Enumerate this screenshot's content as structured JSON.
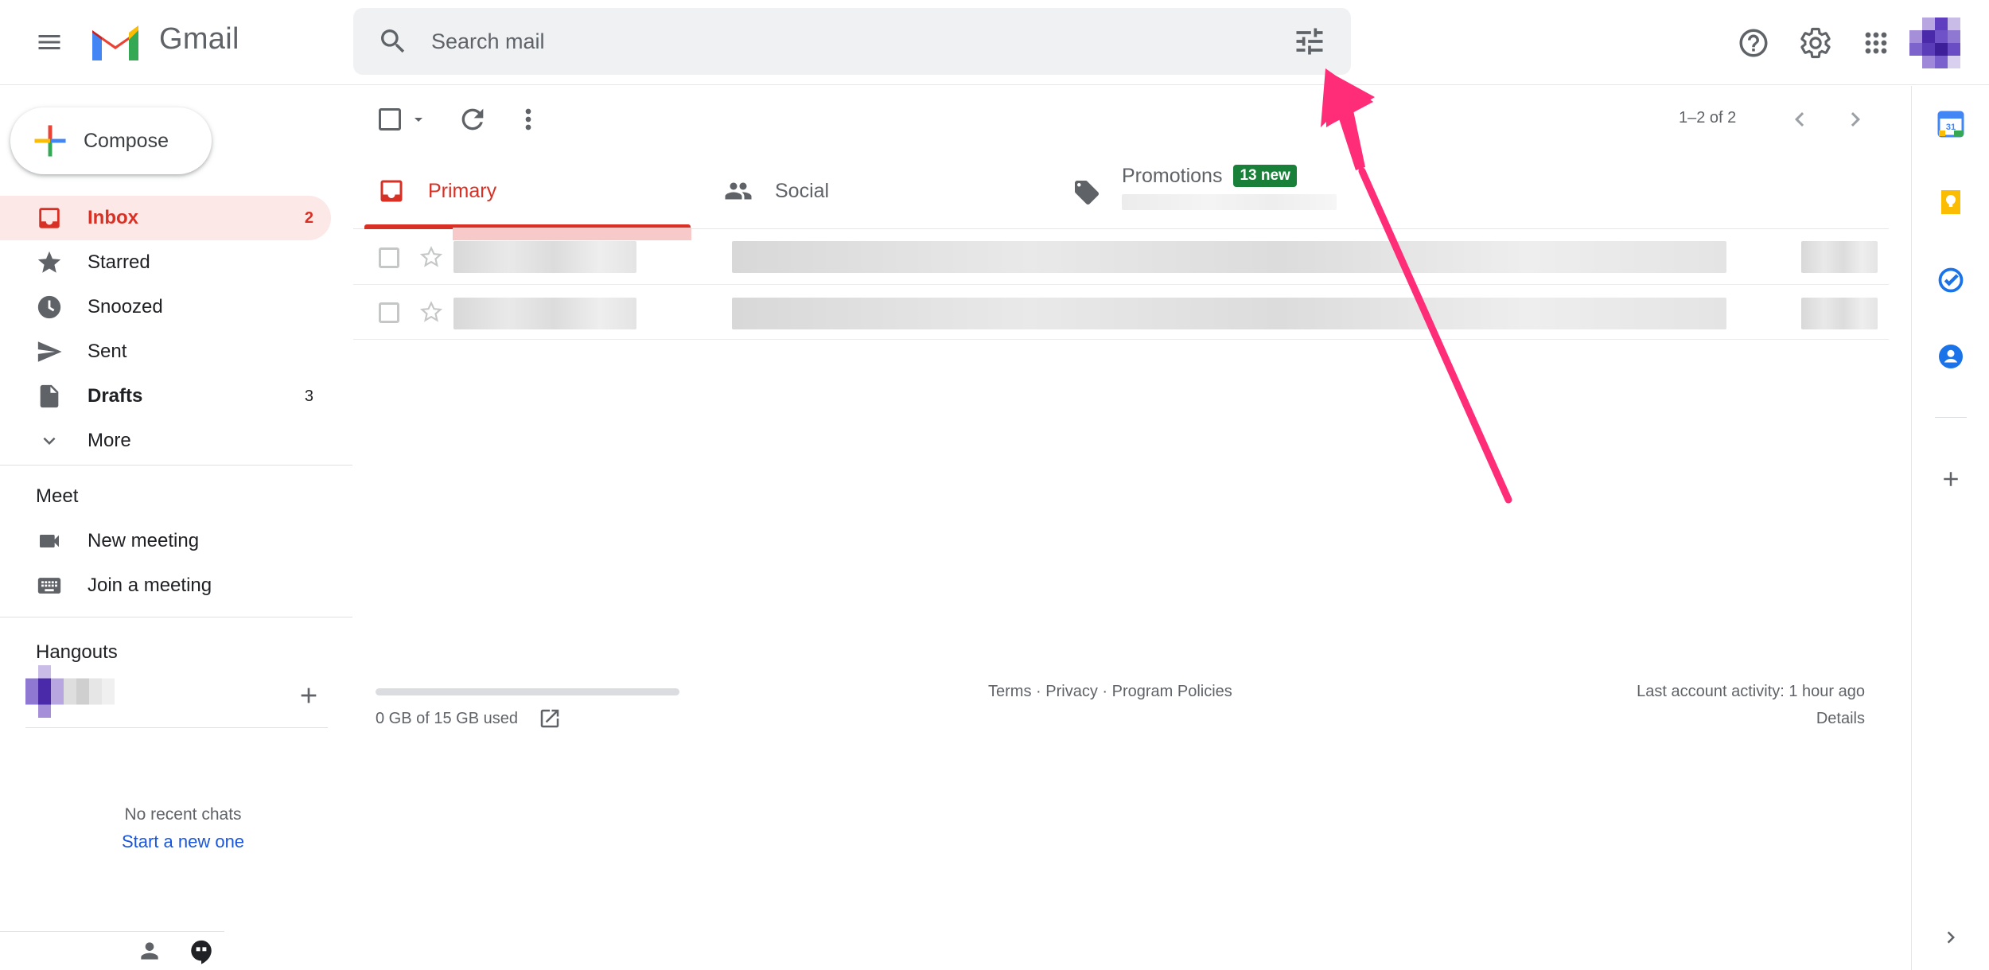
{
  "app": {
    "brand": "Gmail"
  },
  "search": {
    "placeholder": "Search mail"
  },
  "compose": {
    "label": "Compose"
  },
  "sidebar": {
    "items": [
      {
        "label": "Inbox",
        "count": "2",
        "icon": "inbox-icon"
      },
      {
        "label": "Starred",
        "count": "",
        "icon": "star-icon"
      },
      {
        "label": "Snoozed",
        "count": "",
        "icon": "clock-icon"
      },
      {
        "label": "Sent",
        "count": "",
        "icon": "send-icon"
      },
      {
        "label": "Drafts",
        "count": "3",
        "icon": "draft-icon"
      },
      {
        "label": "More",
        "count": "",
        "icon": "chevron-down-icon"
      }
    ],
    "meet": {
      "title": "Meet",
      "items": [
        {
          "label": "New meeting",
          "icon": "videocam-icon"
        },
        {
          "label": "Join a meeting",
          "icon": "keyboard-icon"
        }
      ]
    },
    "hangouts": {
      "title": "Hangouts",
      "no_chats": "No recent chats",
      "start_new": "Start a new one"
    }
  },
  "toolbar": {
    "pager": "1–2 of 2"
  },
  "tabs": [
    {
      "label": "Primary",
      "active": true
    },
    {
      "label": "Social",
      "active": false
    },
    {
      "label": "Promotions",
      "badge": "13 new",
      "active": false
    }
  ],
  "footer": {
    "storage": "0 GB of 15 GB used",
    "storage_used_fraction": 0,
    "terms": "Terms",
    "privacy": "Privacy",
    "policies": "Program Policies",
    "separator": "·",
    "activity": "Last account activity: 1 hour ago",
    "details": "Details"
  },
  "side_panel": {
    "icons": [
      "calendar-icon",
      "keep-icon",
      "tasks-icon",
      "contacts-icon",
      "add-icon",
      "expand-icon"
    ],
    "calendar_day": "31"
  },
  "colors": {
    "accent_red": "#d93025",
    "badge_green": "#188038",
    "annotation_arrow": "#ff2d78"
  }
}
